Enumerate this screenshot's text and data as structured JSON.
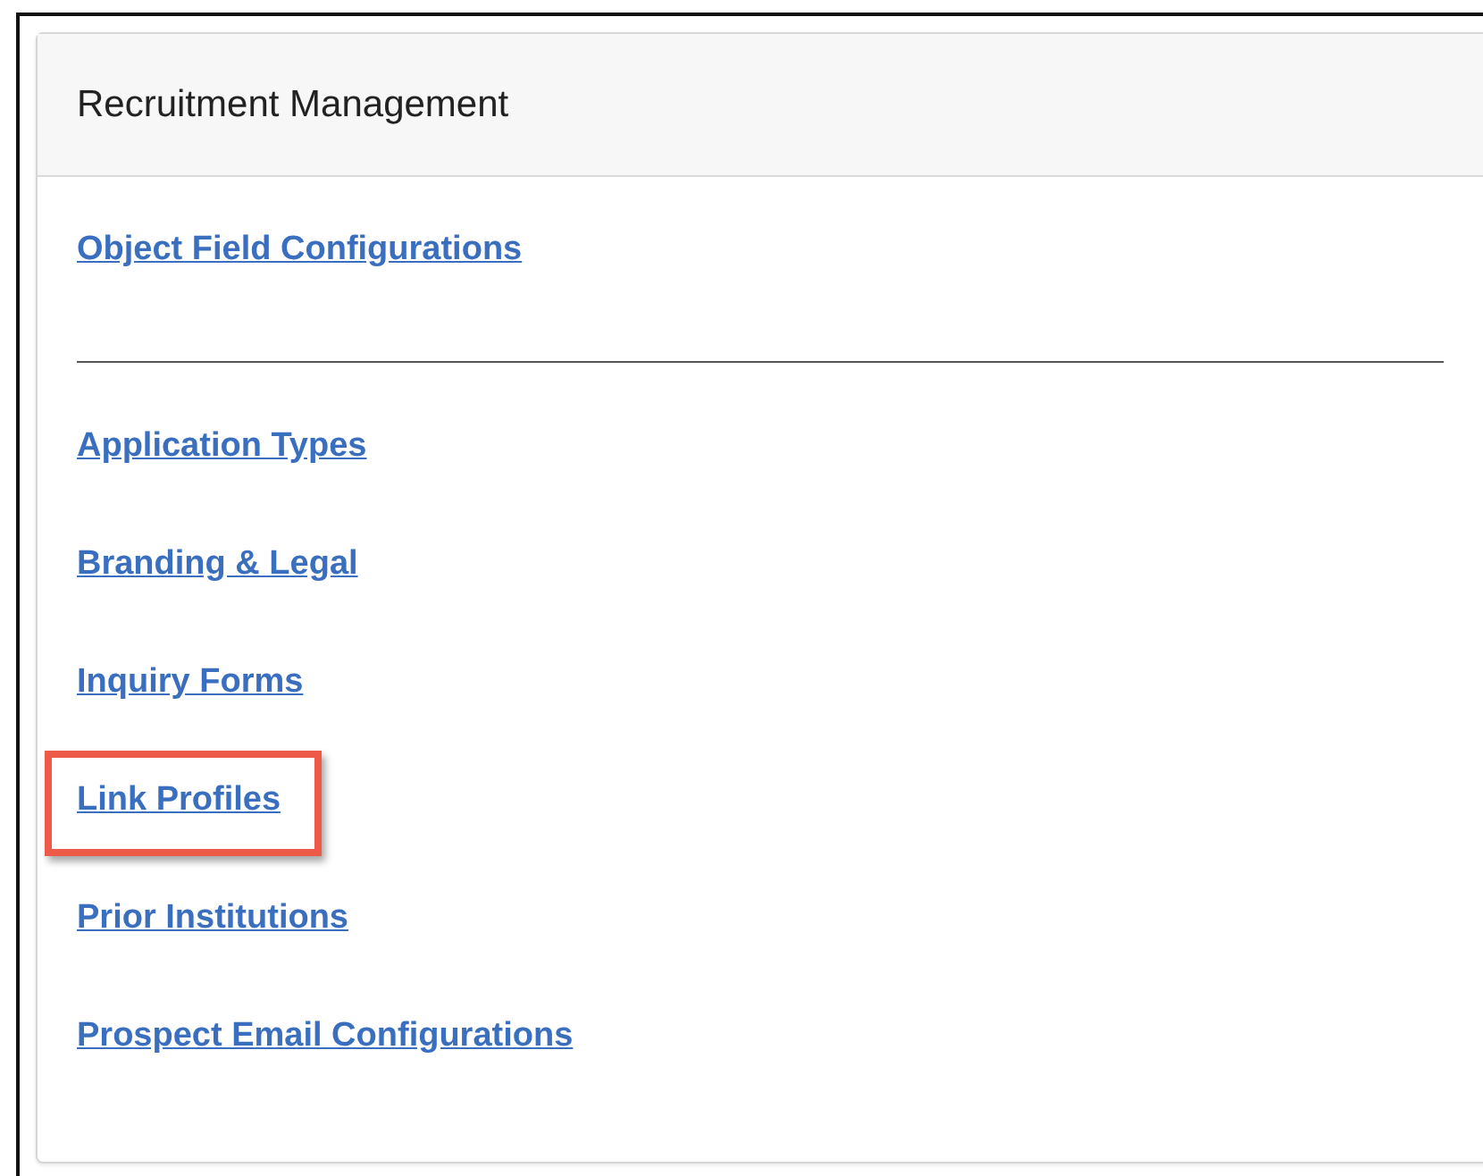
{
  "panel": {
    "title": "Recruitment Management",
    "sections": [
      {
        "links": [
          {
            "label": "Object Field Configurations",
            "highlighted": false
          }
        ]
      },
      {
        "links": [
          {
            "label": "Application Types",
            "highlighted": false
          },
          {
            "label": "Branding & Legal",
            "highlighted": false
          },
          {
            "label": "Inquiry Forms",
            "highlighted": false
          },
          {
            "label": "Link Profiles",
            "highlighted": true
          },
          {
            "label": "Prior Institutions",
            "highlighted": false
          },
          {
            "label": "Prospect Email Configurations",
            "highlighted": false
          }
        ]
      }
    ]
  }
}
